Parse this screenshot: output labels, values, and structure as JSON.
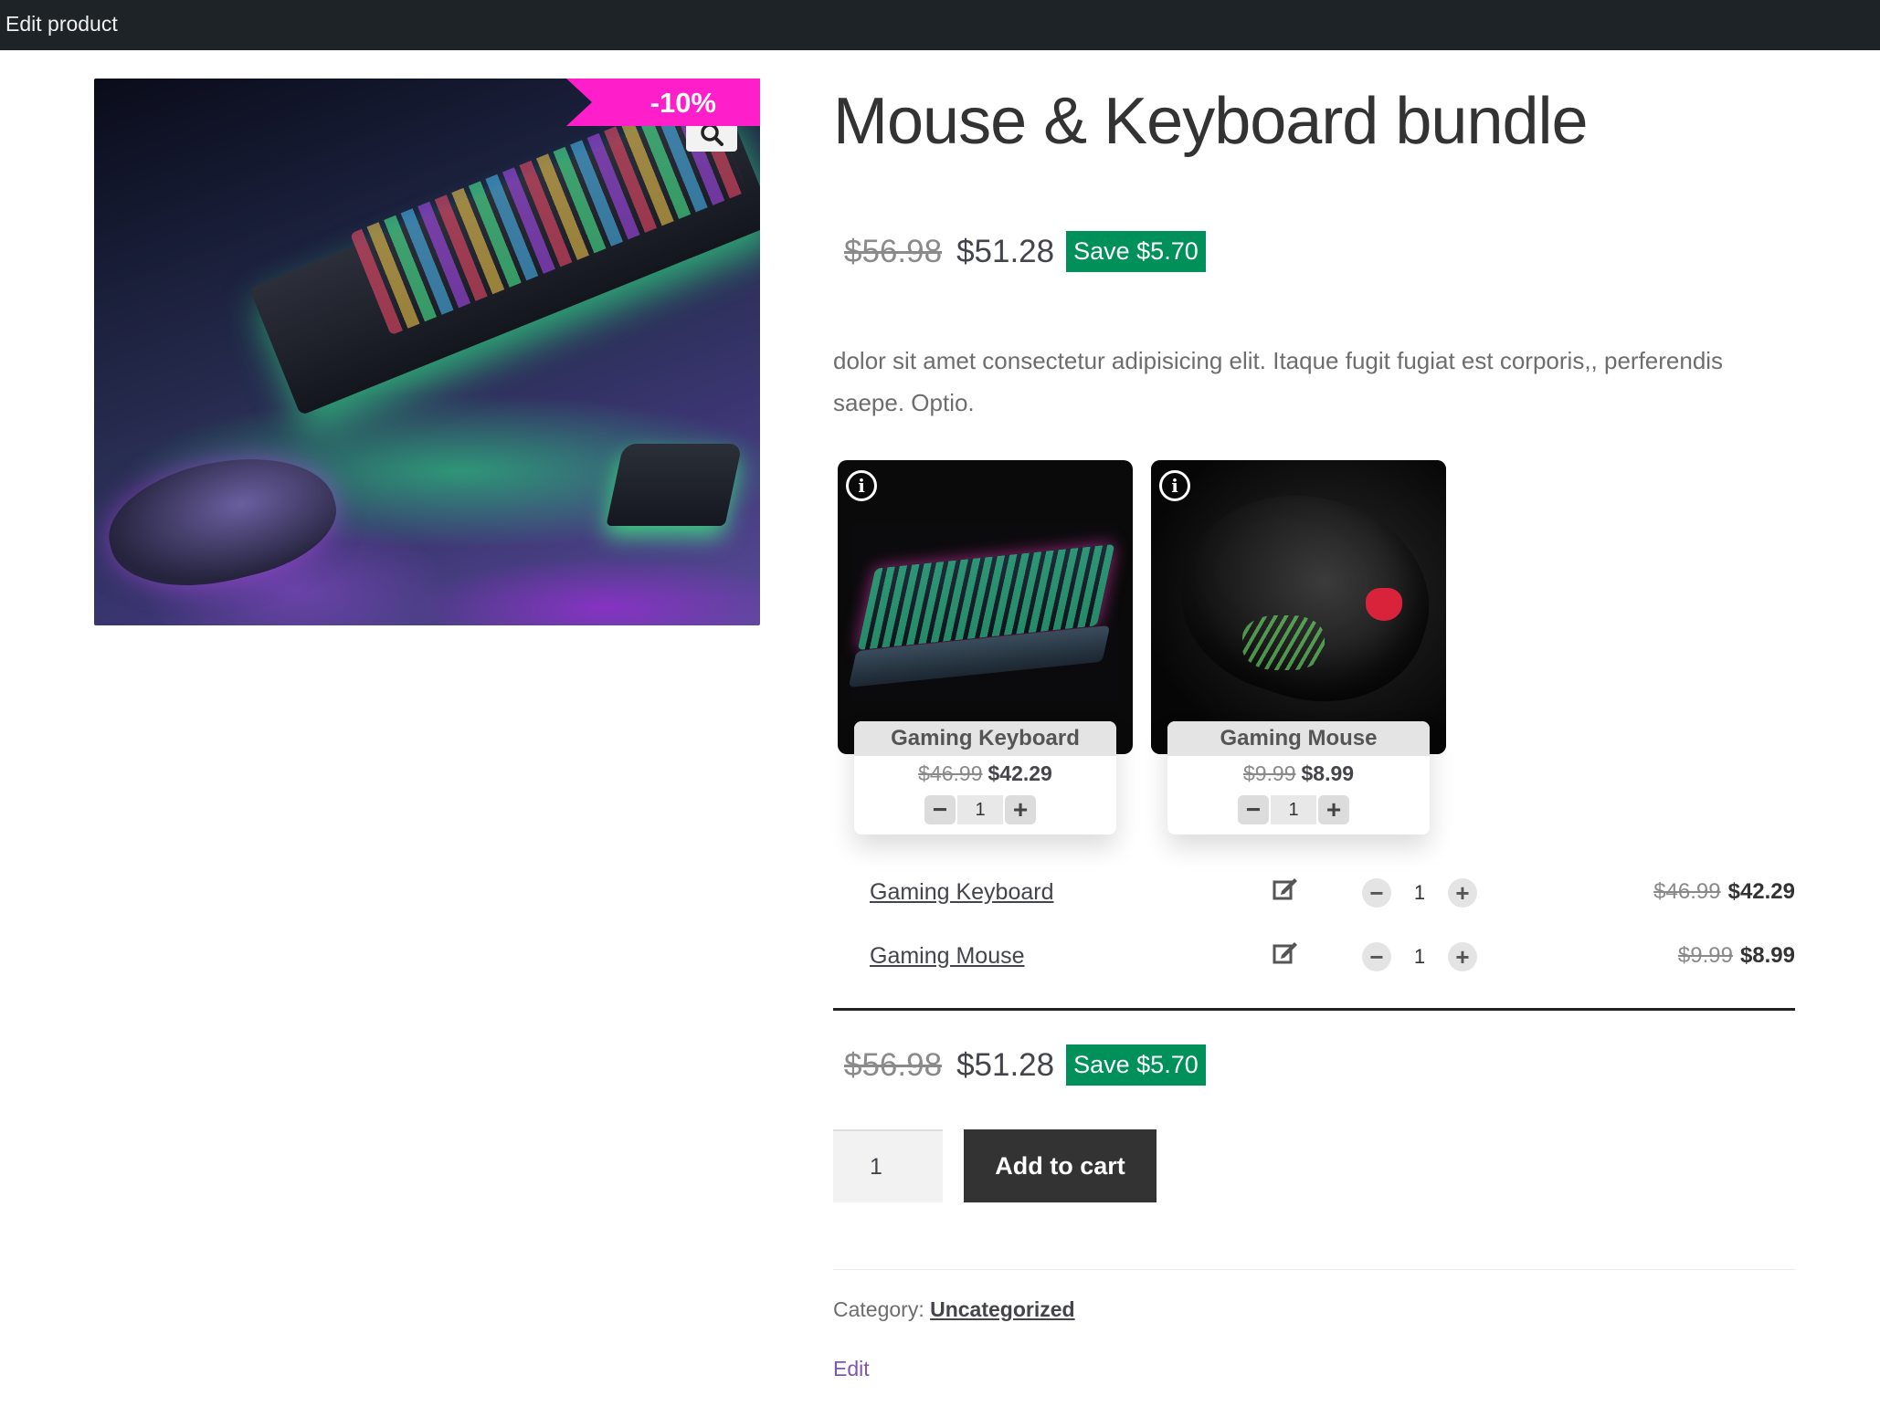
{
  "admin_bar": {
    "edit_product": "Edit product"
  },
  "gallery": {
    "sale_badge": "-10%",
    "zoom_icon": "search-icon"
  },
  "product": {
    "title": "Mouse & Keyboard bundle",
    "old_price": "$56.98",
    "new_price": "$51.28",
    "save_label": "Save $5.70",
    "description": "dolor sit amet consectetur adipisicing elit. Itaque fugit fugiat est corporis,, perferendis saepe. Optio."
  },
  "bundle_cards": [
    {
      "name": "Gaming Keyboard",
      "old_price": "$46.99",
      "new_price": "$42.29",
      "qty": "1"
    },
    {
      "name": "Gaming Mouse",
      "old_price": "$9.99",
      "new_price": "$8.99",
      "qty": "1"
    }
  ],
  "bundle_rows": [
    {
      "name": "Gaming Keyboard",
      "qty": "1",
      "old_price": "$46.99",
      "new_price": "$42.29"
    },
    {
      "name": "Gaming Mouse",
      "qty": "1",
      "old_price": "$9.99",
      "new_price": "$8.99"
    }
  ],
  "total": {
    "old_price": "$56.98",
    "new_price": "$51.28",
    "save_label": "Save $5.70"
  },
  "cart": {
    "qty": "1",
    "add_label": "Add to cart"
  },
  "meta": {
    "category_label": "Category:",
    "category_value": "Uncategorized",
    "edit_label": "Edit"
  },
  "colors": {
    "admin_bar": "#1d2327",
    "sale_badge": "#ff1fca",
    "save_badge": "#00905a",
    "button": "#333333",
    "edit_link": "#7f54b3"
  }
}
